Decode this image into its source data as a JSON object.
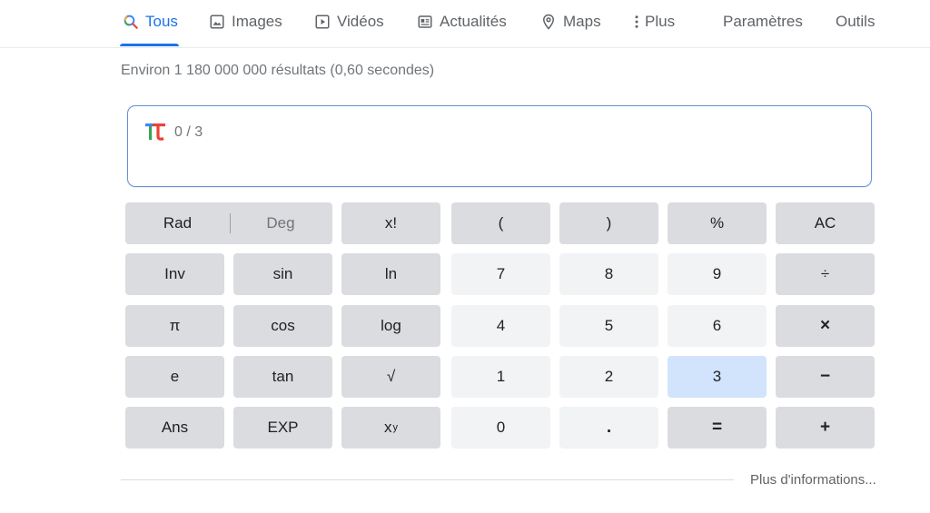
{
  "nav": {
    "tabs": [
      {
        "label": "Tous",
        "icon": "search-icon",
        "active": true
      },
      {
        "label": "Images",
        "icon": "image-icon"
      },
      {
        "label": "Vidéos",
        "icon": "video-icon"
      },
      {
        "label": "Actualités",
        "icon": "news-icon"
      },
      {
        "label": "Maps",
        "icon": "map-pin-icon"
      },
      {
        "label": "Plus",
        "icon": "more-vert-icon"
      }
    ],
    "settings_label": "Paramètres",
    "tools_label": "Outils"
  },
  "result_stats": "Environ 1 180 000 000 résultats (0,60 secondes)",
  "calculator": {
    "expression": "0 / 3",
    "rad_label": "Rad",
    "deg_label": "Deg",
    "keys": {
      "fact": "x!",
      "lparen": "(",
      "rparen": ")",
      "percent": "%",
      "ac": "AC",
      "inv": "Inv",
      "sin": "sin",
      "ln": "ln",
      "seven": "7",
      "eight": "8",
      "nine": "9",
      "divide": "÷",
      "pi": "π",
      "cos": "cos",
      "log": "log",
      "four": "4",
      "five": "5",
      "six": "6",
      "multiply": "×",
      "e": "e",
      "tan": "tan",
      "sqrt": "√",
      "one": "1",
      "two": "2",
      "three": "3",
      "minus": "−",
      "ans": "Ans",
      "exp": "EXP",
      "pow_base": "x",
      "pow_exp": "y",
      "zero": "0",
      "dot": ".",
      "equals": "=",
      "plus": "+"
    }
  },
  "more_info_label": "Plus d'informations...",
  "colors": {
    "accent": "#1a73e8",
    "key_dark": "#dadce0",
    "key_light": "#f1f3f4",
    "key_selected": "#d2e3fc"
  }
}
